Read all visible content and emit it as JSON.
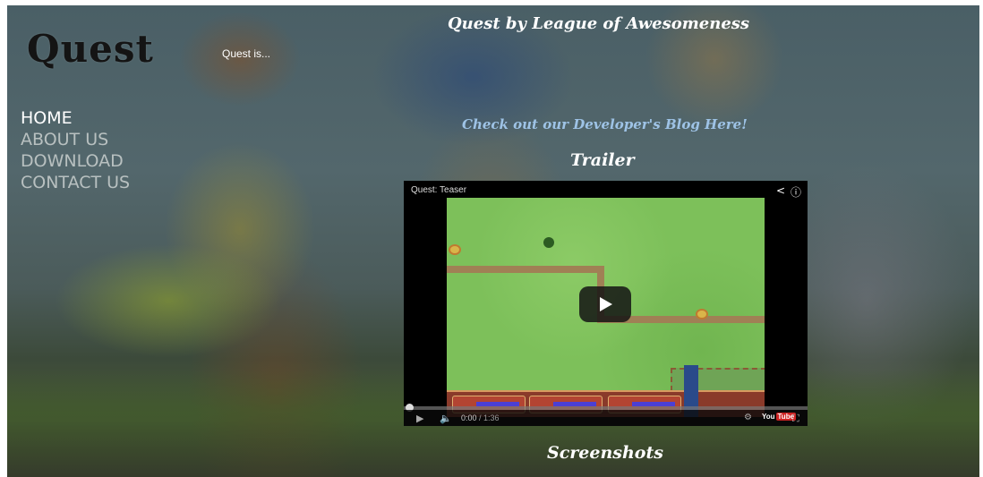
{
  "header": {
    "logo": "Quest",
    "tagline": "Quest is..."
  },
  "nav": {
    "items": [
      {
        "label": "HOME",
        "active": true
      },
      {
        "label": "ABOUT US",
        "active": false
      },
      {
        "label": "DOWNLOAD",
        "active": false
      },
      {
        "label": "CONTACT US",
        "active": false
      }
    ]
  },
  "main": {
    "title": "Quest by League of Awesomeness",
    "blog_link": "Check out our Developer's Blog Here!",
    "trailer_heading": "Trailer",
    "screenshots_heading": "Screenshots"
  },
  "video": {
    "title": "Quest: Teaser",
    "current_time": "0:00",
    "duration": "/ 1:36",
    "progress": 0,
    "logo": "You",
    "logo_tube": "Tube"
  },
  "icons": {
    "share": "share-icon",
    "info": "info-icon",
    "play": "play-icon",
    "volume": "volume-icon",
    "fullscreen": "fullscreen-icon"
  },
  "colors": {
    "nav_inactive": "#b8c0c0",
    "nav_active": "#ffffff",
    "blog_link": "#9ec3e6",
    "youtube_red": "#cc2222"
  }
}
